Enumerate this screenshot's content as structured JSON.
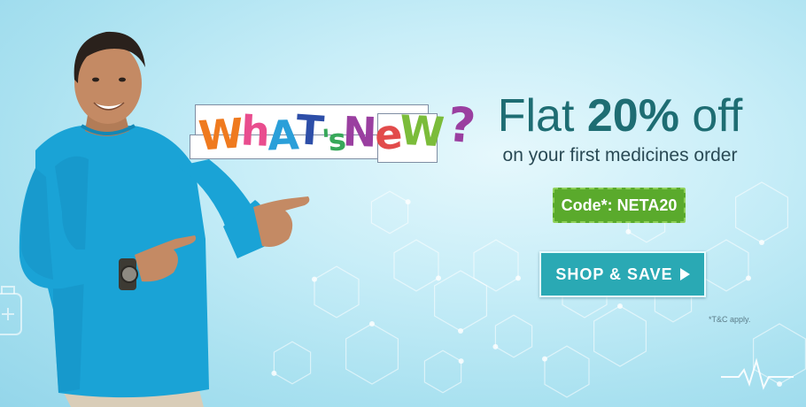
{
  "banner": {
    "sticker_text": "WhATsNeW?",
    "sticker_letters": [
      {
        "ch": "W",
        "color": "#ef7a1f"
      },
      {
        "ch": "h",
        "color": "#e94d8e"
      },
      {
        "ch": "A",
        "color": "#2a9fd9"
      },
      {
        "ch": "T",
        "color": "#2d4ea8"
      },
      {
        "ch": "'s",
        "color": "#38a85a"
      },
      {
        "ch": "N",
        "color": "#9a3fa0"
      },
      {
        "ch": "e",
        "color": "#e24b4b"
      },
      {
        "ch": "W",
        "color": "#7bbc3a"
      },
      {
        "ch": "?",
        "color": "#9a3fa0"
      }
    ],
    "headline_prefix": "Flat",
    "headline_highlight": "20%",
    "headline_suffix": "off",
    "subheadline": "on your first medicines order",
    "code_label": "Code*:",
    "code_value": "NETA20",
    "cta_label": "SHOP & SAVE",
    "terms": "*T&C apply."
  },
  "colors": {
    "headline": "#1e6d73",
    "code_badge": "#5aaa2c",
    "cta": "#2aa9b4",
    "background": "#c9eef8",
    "sweater": "#1aa3d6"
  },
  "icons": {
    "cta_arrow": "play-triangle-icon",
    "pulse": "heartbeat-icon",
    "side": "medical-kit-icon"
  }
}
